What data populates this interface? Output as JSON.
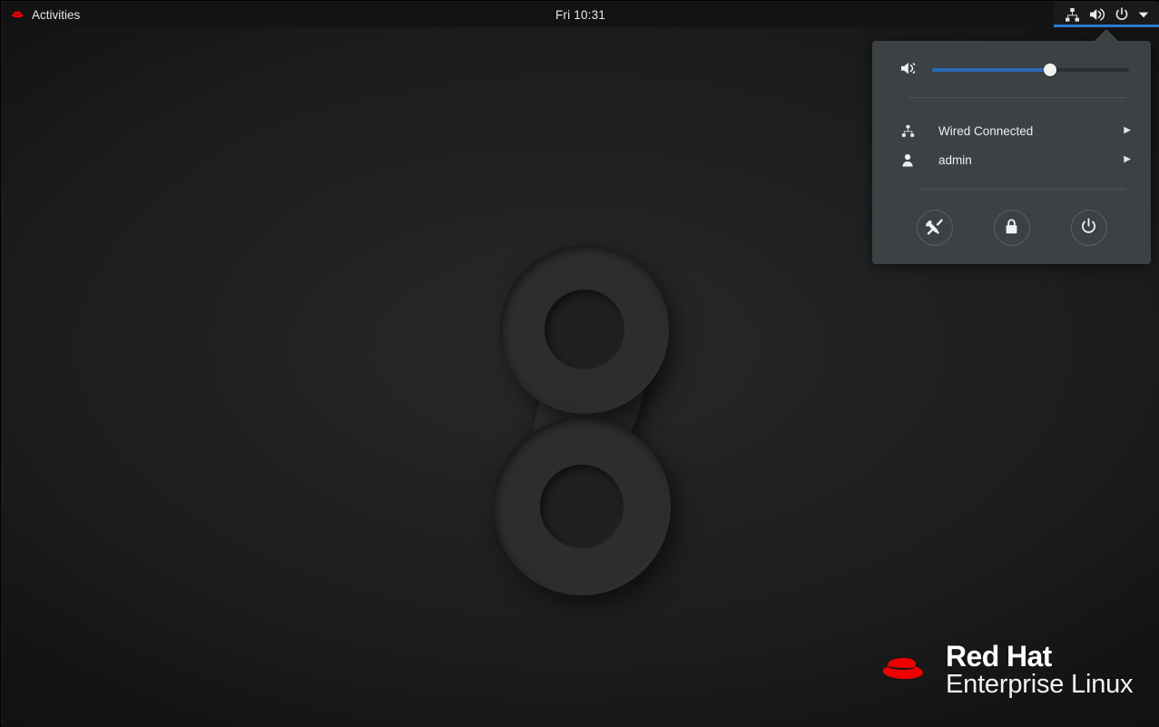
{
  "topbar": {
    "activities_label": "Activities",
    "activities_icon": "redhat-fedora-icon",
    "clock": "Fri 10:31",
    "system_icons": [
      {
        "name": "wired-network-icon",
        "label": "Wired network"
      },
      {
        "name": "volume-icon",
        "label": "Volume"
      },
      {
        "name": "power-icon",
        "label": "Power"
      },
      {
        "name": "chevron-down-icon",
        "label": "Open system menu"
      }
    ],
    "accent_color": "#2e77d0",
    "background_color": "#131313"
  },
  "status_menu": {
    "background_color": "#3c4244",
    "volume": {
      "icon": "volume-medium-icon",
      "value": 60,
      "fill_color": "#2b6cb8",
      "knob_color": "#f2f2f2"
    },
    "rows": [
      {
        "id": "network",
        "icon": "wired-network-icon",
        "label": "Wired Connected",
        "caret": "▶"
      },
      {
        "id": "user",
        "icon": "user-icon",
        "label": "admin",
        "caret": "▶"
      }
    ],
    "actions": [
      {
        "id": "settings",
        "icon": "settings-tools-icon",
        "label": "Settings"
      },
      {
        "id": "lock",
        "icon": "lock-icon",
        "label": "Lock"
      },
      {
        "id": "power",
        "icon": "power-icon",
        "label": "Power Off / Log Out"
      }
    ]
  },
  "branding": {
    "logo_icon": "redhat-fedora-logo",
    "logo_color": "#ee0000",
    "line1": "Red Hat",
    "line2": "Enterprise Linux"
  },
  "wallpaper": {
    "motif": "rhel-8-numeral",
    "background_color": "#1f1f21"
  }
}
